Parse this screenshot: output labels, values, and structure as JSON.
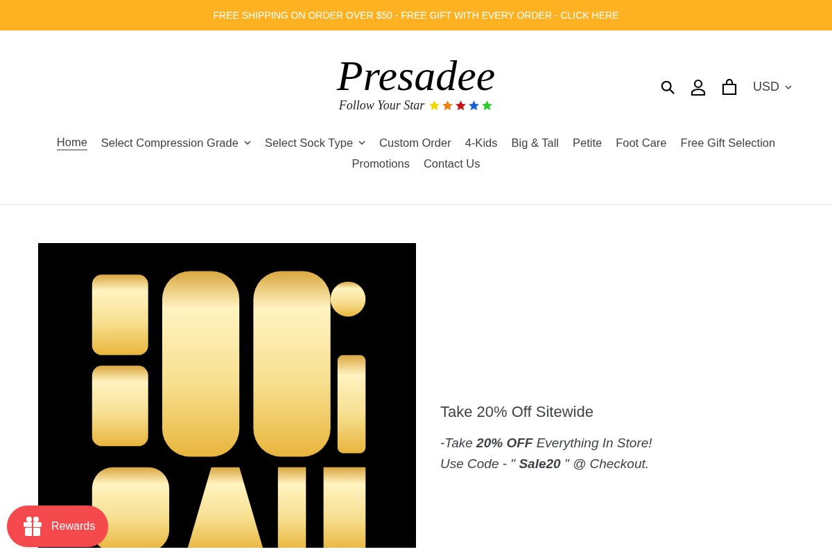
{
  "announcement": "FREE SHIPPING ON ORDER OVER $50 - FREE GIFT WITH EVERY ORDER - CLICK HERE",
  "logo": {
    "name": "Presadee",
    "tagline": "Follow Your Star",
    "stars": [
      {
        "color": "#f5d800"
      },
      {
        "color": "#f07f10"
      },
      {
        "color": "#c41414"
      },
      {
        "color": "#1a5fd6"
      },
      {
        "color": "#2ccc2c"
      }
    ]
  },
  "header": {
    "currency": "USD"
  },
  "nav": [
    {
      "label": "Home",
      "selected": true,
      "dropdown": false
    },
    {
      "label": "Select Compression Grade",
      "selected": false,
      "dropdown": true
    },
    {
      "label": "Select Sock Type",
      "selected": false,
      "dropdown": true
    },
    {
      "label": "Custom Order",
      "selected": false,
      "dropdown": false
    },
    {
      "label": "4-Kids",
      "selected": false,
      "dropdown": false
    },
    {
      "label": "Big & Tall",
      "selected": false,
      "dropdown": false
    },
    {
      "label": "Petite",
      "selected": false,
      "dropdown": false
    },
    {
      "label": "Foot Care",
      "selected": false,
      "dropdown": false
    },
    {
      "label": "Free Gift Selection",
      "selected": false,
      "dropdown": false
    },
    {
      "label": "Promotions",
      "selected": false,
      "dropdown": false
    },
    {
      "label": "Contact Us",
      "selected": false,
      "dropdown": false
    }
  ],
  "promo": {
    "title": "Take 20% Off Sitewide",
    "lines": [
      "-Take **20% OFF** Everything In Store!",
      "Use Code - \" **Sale20** \" @ Checkout."
    ]
  },
  "rewards": {
    "label": "Rewards"
  }
}
